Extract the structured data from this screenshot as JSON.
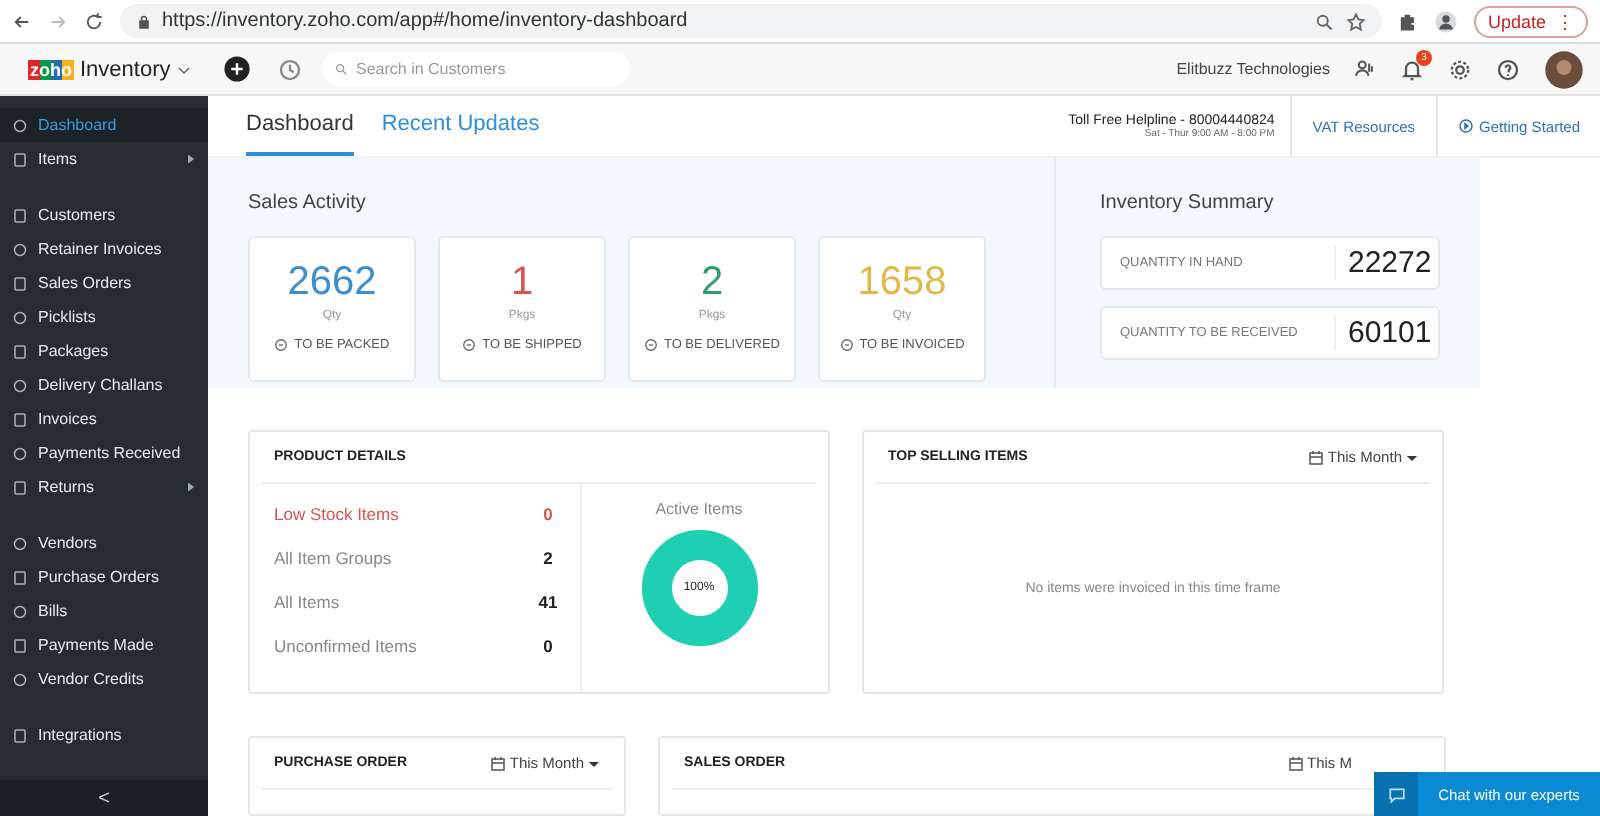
{
  "browser": {
    "url": "https://inventory.zoho.com/app#/home/inventory-dashboard",
    "update_button": "Update",
    "menu_glyph": "⋮"
  },
  "header": {
    "logo": "zoho",
    "product": "Inventory",
    "search_placeholder": "Search in Customers",
    "organization": "Elitbuzz Technologies",
    "notification_count": "3"
  },
  "sidebar": {
    "groups": [
      [
        {
          "label": "Dashboard",
          "selected": true,
          "submenu": false
        },
        {
          "label": "Items",
          "selected": false,
          "submenu": true
        }
      ],
      [
        {
          "label": "Customers",
          "selected": false,
          "submenu": false
        },
        {
          "label": "Retainer Invoices",
          "selected": false,
          "submenu": false
        },
        {
          "label": "Sales Orders",
          "selected": false,
          "submenu": false
        },
        {
          "label": "Picklists",
          "selected": false,
          "submenu": false
        },
        {
          "label": "Packages",
          "selected": false,
          "submenu": false
        },
        {
          "label": "Delivery Challans",
          "selected": false,
          "submenu": false
        },
        {
          "label": "Invoices",
          "selected": false,
          "submenu": false
        },
        {
          "label": "Payments Received",
          "selected": false,
          "submenu": false
        },
        {
          "label": "Returns",
          "selected": false,
          "submenu": true
        }
      ],
      [
        {
          "label": "Vendors",
          "selected": false,
          "submenu": false
        },
        {
          "label": "Purchase Orders",
          "selected": false,
          "submenu": false
        },
        {
          "label": "Bills",
          "selected": false,
          "submenu": false
        },
        {
          "label": "Payments Made",
          "selected": false,
          "submenu": false
        },
        {
          "label": "Vendor Credits",
          "selected": false,
          "submenu": false
        }
      ],
      [
        {
          "label": "Integrations",
          "selected": false,
          "submenu": false
        }
      ]
    ],
    "collapse_glyph": "<"
  },
  "tabs": [
    {
      "label": "Dashboard",
      "selected": true
    },
    {
      "label": "Recent Updates",
      "selected": false
    }
  ],
  "helpline": {
    "title": "Toll Free Helpline - 80004440824",
    "hours": "Sat - Thur 9:00 AM - 8:00 PM"
  },
  "links": [
    "VAT Resources",
    "Getting Started"
  ],
  "sales_activity": {
    "title": "Sales Activity",
    "cards": [
      {
        "value": "2662",
        "unit": "Qty",
        "label": "TO BE PACKED",
        "color": "#3b8fd0"
      },
      {
        "value": "1",
        "unit": "Pkgs",
        "label": "TO BE SHIPPED",
        "color": "#d9534f"
      },
      {
        "value": "2",
        "unit": "Pkgs",
        "label": "TO BE DELIVERED",
        "color": "#2e9d6b"
      },
      {
        "value": "1658",
        "unit": "Qty",
        "label": "TO BE INVOICED",
        "color": "#e0b84c"
      }
    ]
  },
  "inventory_summary": {
    "title": "Inventory Summary",
    "rows": [
      {
        "label": "QUANTITY IN HAND",
        "value": "22272"
      },
      {
        "label": "QUANTITY TO BE RECEIVED",
        "value": "60101"
      }
    ]
  },
  "product_details": {
    "title": "PRODUCT DETAILS",
    "rows": [
      {
        "label": "Low Stock Items",
        "value": "0",
        "alert": true
      },
      {
        "label": "All Item Groups",
        "value": "2",
        "alert": false
      },
      {
        "label": "All Items",
        "value": "41",
        "alert": false
      },
      {
        "label": "Unconfirmed Items",
        "value": "0",
        "alert": false
      }
    ],
    "donut_title": "Active Items",
    "donut_label": "100%"
  },
  "top_selling": {
    "title": "TOP SELLING ITEMS",
    "period": "This Month",
    "empty": "No items were invoiced in this time frame"
  },
  "purchase_order": {
    "title": "PURCHASE ORDER",
    "period": "This Month"
  },
  "sales_order": {
    "title": "SALES ORDER",
    "period": "This M"
  },
  "chat_button": "Chat with our experts"
}
